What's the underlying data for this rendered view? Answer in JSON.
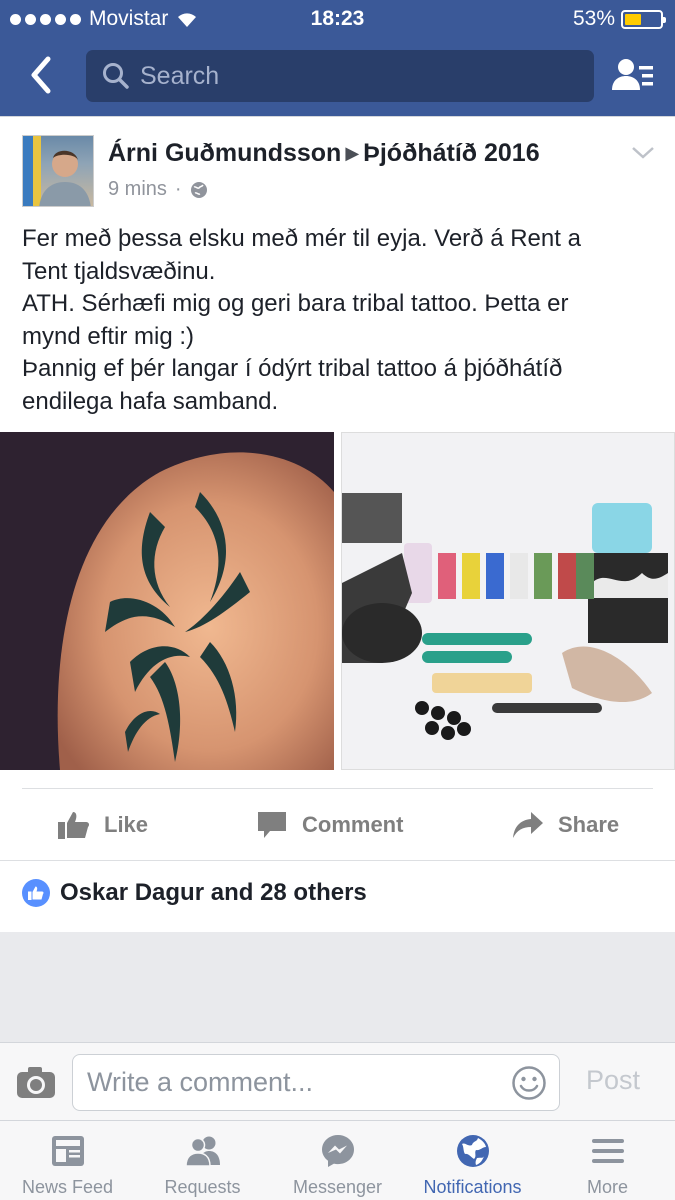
{
  "status_bar": {
    "carrier": "Movistar",
    "time": "18:23",
    "battery": "53%",
    "battery_level": 0.53
  },
  "nav": {
    "search_placeholder": "Search"
  },
  "post": {
    "author": "Árni Guðmundsson",
    "target": "Þjóðhátíð 2016",
    "time": "9 mins",
    "privacy_icon": "globe-icon",
    "text_lines": [
      "Fer með þessa elsku með mér til eyja. Verð á Rent a",
      "Tent tjaldsvæðinu.",
      "ATH. Sérhæfi mig og geri bara tribal tattoo. Þetta er",
      "mynd eftir mig :)",
      "Þannig ef þér langar í ódýrt tribal tattoo á þjóðhátíð",
      "endilega hafa samband."
    ],
    "actions": {
      "like": "Like",
      "comment": "Comment",
      "share": "Share"
    },
    "reactions": "Oskar Dagur and 28 others"
  },
  "comment_bar": {
    "placeholder": "Write a comment...",
    "post_label": "Post"
  },
  "tabs": [
    {
      "label": "News Feed",
      "icon": "news-feed-icon",
      "active": false
    },
    {
      "label": "Requests",
      "icon": "requests-icon",
      "active": false
    },
    {
      "label": "Messenger",
      "icon": "messenger-icon",
      "active": false
    },
    {
      "label": "Notifications",
      "icon": "globe-icon",
      "active": true
    },
    {
      "label": "More",
      "icon": "menu-icon",
      "active": false
    }
  ],
  "colors": {
    "brand": "#3b5998",
    "active_tab": "#4267b2",
    "battery": "#ffcc00",
    "like_badge": "#5890ff"
  }
}
